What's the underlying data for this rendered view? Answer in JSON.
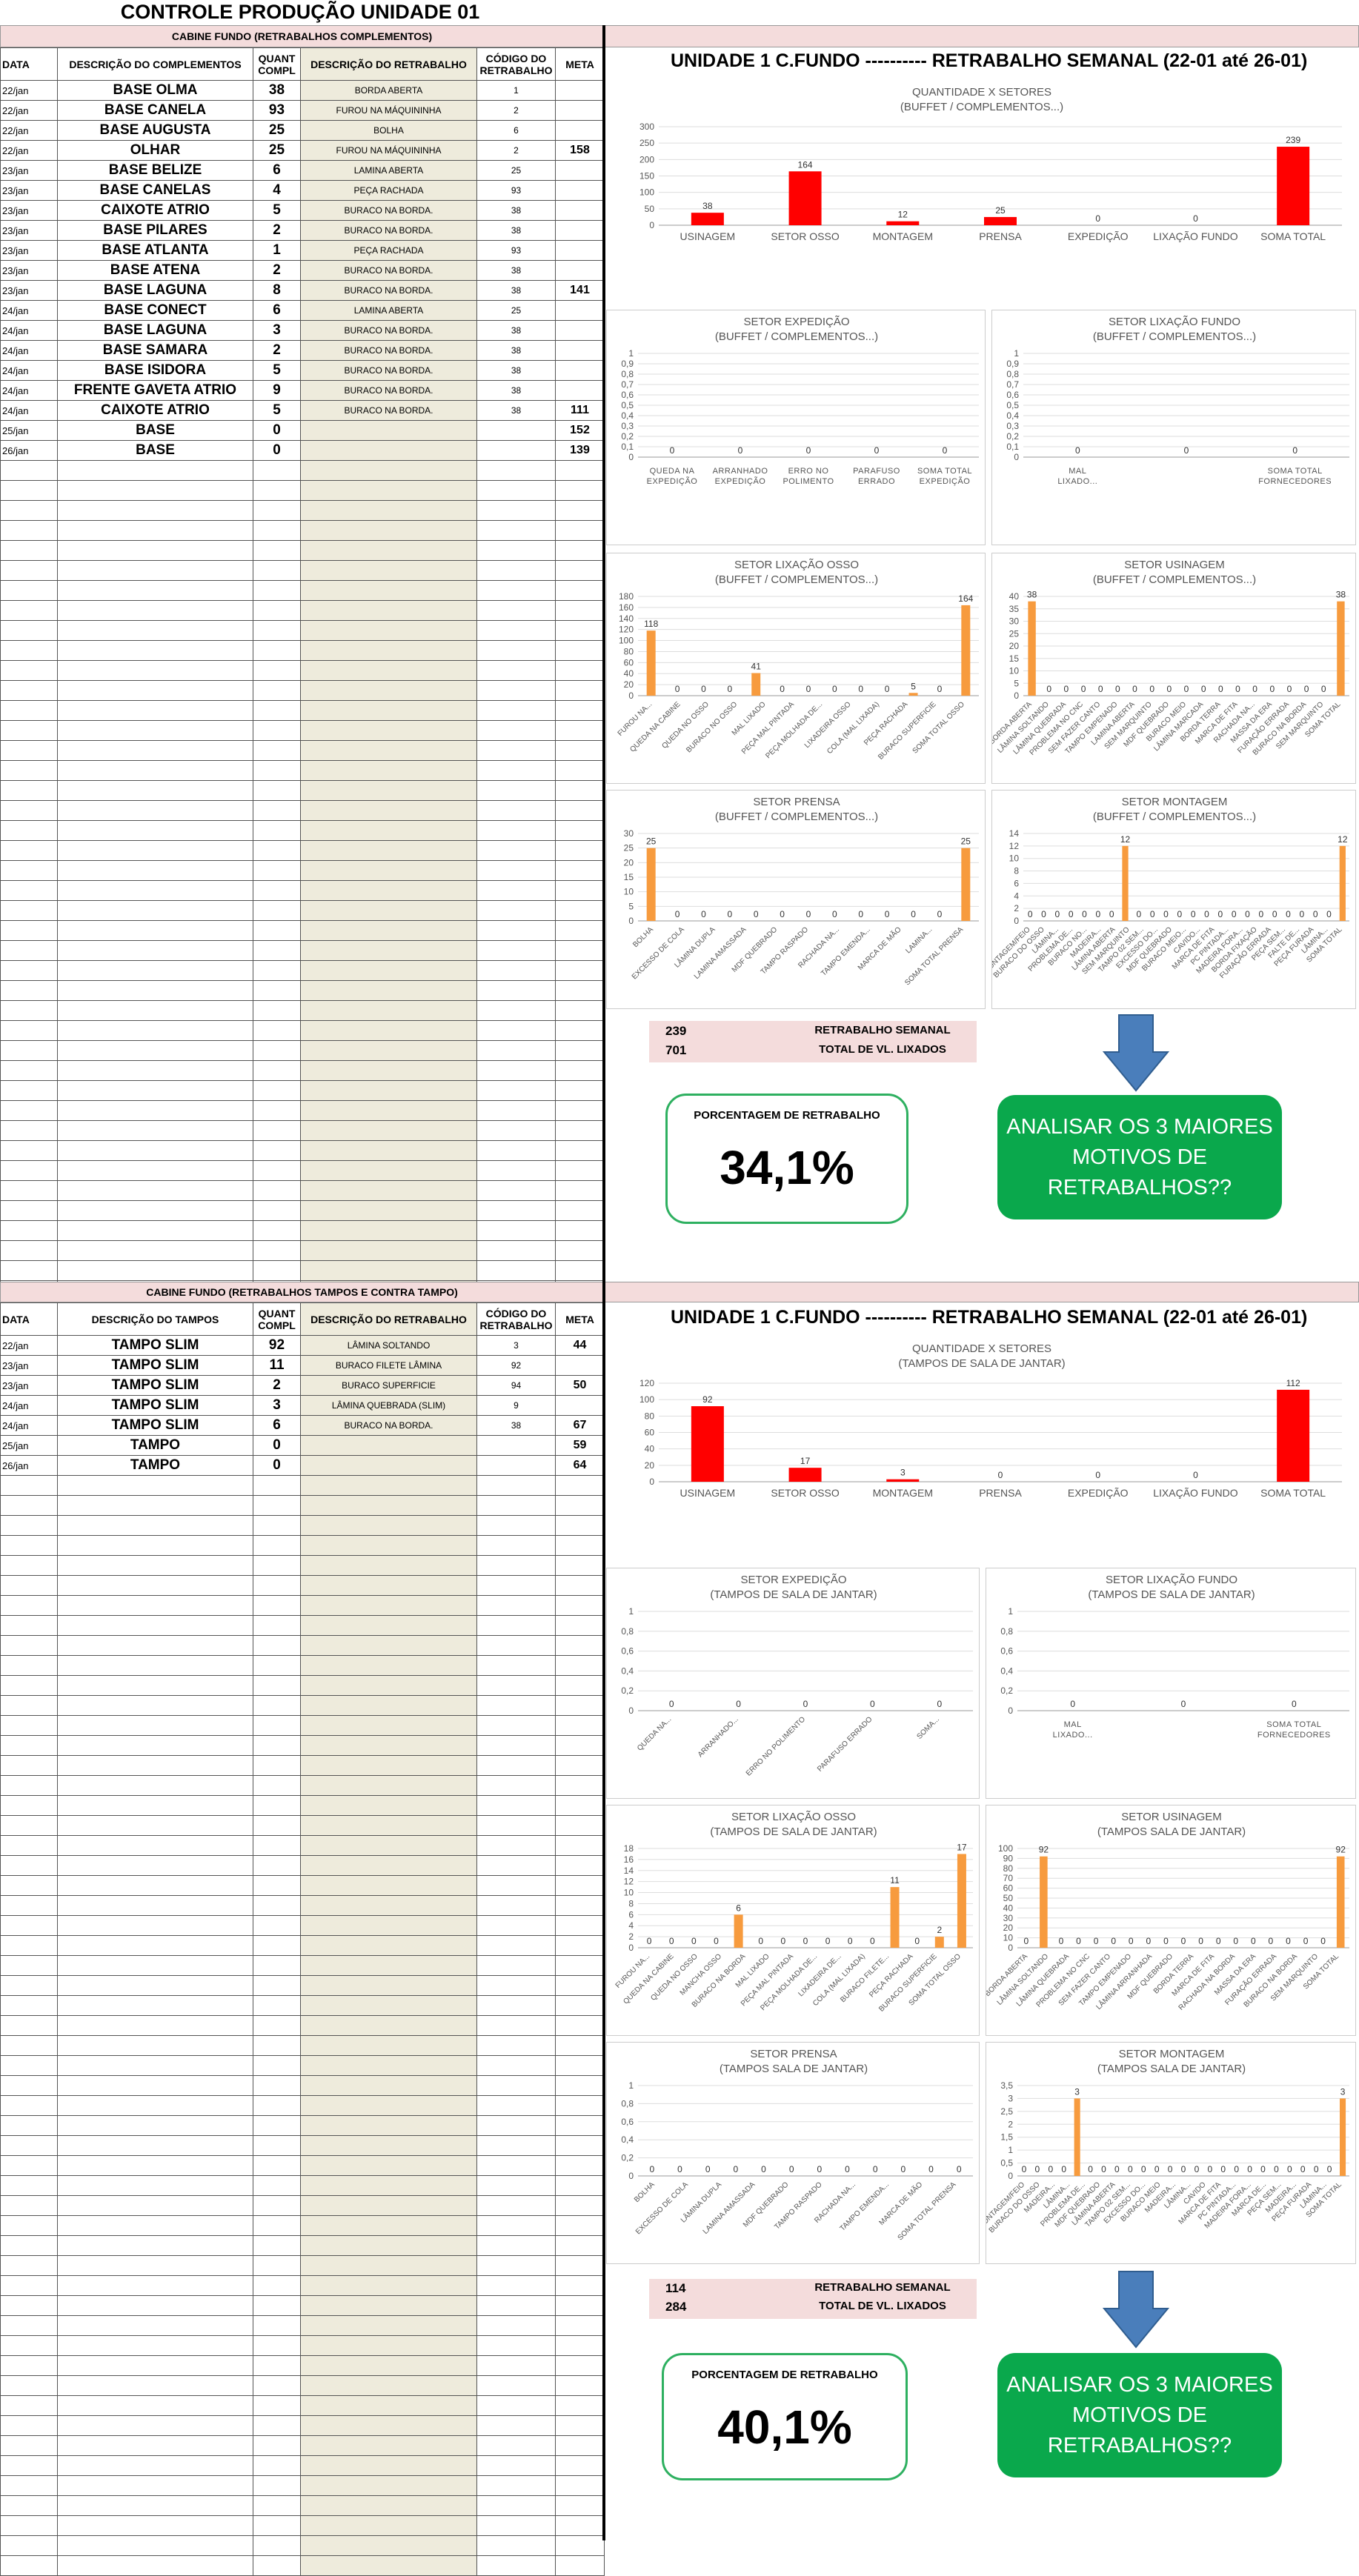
{
  "page_title": "CONTROLE PRODUÇÃO UNIDADE 01",
  "headers": {
    "data": "DATA",
    "descr_compl": "DESCRIÇÃO DO COMPLEMENTOS",
    "quant": "QUANT COMPL",
    "descr_retrab": "DESCRIÇÃO DO RETRABALHO",
    "codigo": "CÓDIGO DO RETRABALHO",
    "meta": "META",
    "descr_tampos": "DESCRIÇÃO DO TAMPOS"
  },
  "section1": {
    "band": "CABINE FUNDO (RETRABALHOS COMPLEMENTOS)",
    "rows": [
      [
        "22/jan",
        "BASE OLMA",
        "38",
        "BORDA ABERTA",
        "1",
        ""
      ],
      [
        "22/jan",
        "BASE CANELA",
        "93",
        "FUROU NA MÁQUININHA",
        "2",
        ""
      ],
      [
        "22/jan",
        "BASE AUGUSTA",
        "25",
        "BOLHA",
        "6",
        ""
      ],
      [
        "22/jan",
        "OLHAR",
        "25",
        "FUROU NA MÁQUININHA",
        "2",
        "158"
      ],
      [
        "23/jan",
        "BASE BELIZE",
        "6",
        "LAMINA ABERTA",
        "25",
        ""
      ],
      [
        "23/jan",
        "BASE CANELAS",
        "4",
        "PEÇA RACHADA",
        "93",
        ""
      ],
      [
        "23/jan",
        "CAIXOTE ATRIO",
        "5",
        "BURACO NA BORDA.",
        "38",
        ""
      ],
      [
        "23/jan",
        "BASE PILARES",
        "2",
        "BURACO NA BORDA.",
        "38",
        ""
      ],
      [
        "23/jan",
        "BASE ATLANTA",
        "1",
        "PEÇA RACHADA",
        "93",
        ""
      ],
      [
        "23/jan",
        "BASE ATENA",
        "2",
        "BURACO NA BORDA.",
        "38",
        ""
      ],
      [
        "23/jan",
        "BASE LAGUNA",
        "8",
        "BURACO NA BORDA.",
        "38",
        "141"
      ],
      [
        "24/jan",
        "BASE CONECT",
        "6",
        "LAMINA ABERTA",
        "25",
        ""
      ],
      [
        "24/jan",
        "BASE LAGUNA",
        "3",
        "BURACO NA BORDA.",
        "38",
        ""
      ],
      [
        "24/jan",
        "BASE SAMARA",
        "2",
        "BURACO NA BORDA.",
        "38",
        ""
      ],
      [
        "24/jan",
        "BASE ISIDORA",
        "5",
        "BURACO NA BORDA.",
        "38",
        ""
      ],
      [
        "24/jan",
        "FRENTE GAVETA ATRIO",
        "9",
        "BURACO NA BORDA.",
        "38",
        ""
      ],
      [
        "24/jan",
        "CAIXOTE ATRIO",
        "5",
        "BURACO NA BORDA.",
        "38",
        "111"
      ],
      [
        "25/jan",
        "BASE",
        "0",
        "",
        "",
        "152"
      ],
      [
        "26/jan",
        "BASE",
        "0",
        "",
        "",
        "139"
      ]
    ],
    "main_title": "UNIDADE 1 C.FUNDO ----------   RETRABALHO SEMANAL (22-01 até 26-01)",
    "summary": {
      "val1": "239",
      "lbl1": "RETRABALHO SEMANAL",
      "val2": "701",
      "lbl2": "TOTAL DE VL. LIXADOS"
    },
    "pct_label": "PORCENTAGEM DE RETRABALHO",
    "pct_value": "34,1%",
    "action_text": "ANALISAR OS 3 MAIORES MOTIVOS DE RETRABALHOS??"
  },
  "section2": {
    "band": "CABINE FUNDO (RETRABALHOS TAMPOS E CONTRA TAMPO)",
    "rows": [
      [
        "22/jan",
        "TAMPO SLIM",
        "92",
        "LÂMINA SOLTANDO",
        "3",
        "44"
      ],
      [
        "23/jan",
        "TAMPO SLIM",
        "11",
        "BURACO FILETE LÂMINA",
        "92",
        ""
      ],
      [
        "23/jan",
        "TAMPO SLIM",
        "2",
        "BURACO SUPERFICIE",
        "94",
        "50"
      ],
      [
        "24/jan",
        "TAMPO SLIM",
        "3",
        "LÂMINA QUEBRADA (SLIM)",
        "9",
        ""
      ],
      [
        "24/jan",
        "TAMPO SLIM",
        "6",
        "BURACO NA BORDA.",
        "38",
        "67"
      ],
      [
        "25/jan",
        "TAMPO",
        "0",
        "",
        "",
        "59"
      ],
      [
        "26/jan",
        "TAMPO",
        "0",
        "",
        "",
        "64"
      ]
    ],
    "main_title": "UNIDADE 1 C.FUNDO ----------   RETRABALHO SEMANAL (22-01 até 26-01)",
    "summary": {
      "val1": "114",
      "lbl1": "RETRABALHO SEMANAL",
      "val2": "284",
      "lbl2": "TOTAL DE VL. LIXADOS"
    },
    "pct_label": "PORCENTAGEM DE RETRABALHO",
    "pct_value": "40,1%",
    "action_text": "ANALISAR OS 3 MAIORES MOTIVOS DE RETRABALHOS??"
  },
  "colors": {
    "red": "#ff0000",
    "orange": "#f79b3e",
    "green": "#0aa84c",
    "arrow": "#4a7ebb",
    "pink": "#f4dcdc"
  },
  "chart_data": [
    {
      "id": "c1",
      "type": "bar",
      "title": "QUANTIDADE X SETORES",
      "subtitle": "(BUFFET / COMPLEMENTOS...)",
      "color": "red",
      "categories": [
        "USINAGEM",
        "SETOR OSSO",
        "MONTAGEM",
        "PRENSA",
        "EXPEDIÇÃO",
        "LIXAÇÃO FUNDO",
        "SOMA TOTAL"
      ],
      "values": [
        38,
        164,
        12,
        25,
        0,
        0,
        239
      ],
      "ylim": [
        0,
        300
      ],
      "yticks": [
        0,
        50,
        100,
        150,
        200,
        250,
        300
      ]
    },
    {
      "id": "c2",
      "type": "bar",
      "title": "SETOR EXPEDIÇÃO",
      "subtitle": "(BUFFET / COMPLEMENTOS...)",
      "color": "orange",
      "categories": [
        "QUEDA NA EXPEDIÇÃO",
        "ARRANHADO EXPEDIÇÃO",
        "ERRO NO POLIMENTO",
        "PARAFUSO ERRADO",
        "SOMA TOTAL EXPEDIÇÃO"
      ],
      "values": [
        0,
        0,
        0,
        0,
        0
      ],
      "ylim": [
        0,
        1
      ],
      "yticks": [
        0,
        0.1,
        0.2,
        0.3,
        0.4,
        0.5,
        0.6,
        0.7,
        0.8,
        0.9,
        1
      ]
    },
    {
      "id": "c3",
      "type": "bar",
      "title": "SETOR LIXAÇÃO FUNDO",
      "subtitle": "(BUFFET / COMPLEMENTOS...)",
      "color": "orange",
      "categories": [
        "MAL LIXADO...",
        "",
        "SOMA TOTAL FORNECEDORES"
      ],
      "values": [
        0,
        0,
        0
      ],
      "ylim": [
        0,
        1
      ],
      "yticks": [
        0,
        0.1,
        0.2,
        0.3,
        0.4,
        0.5,
        0.6,
        0.7,
        0.8,
        0.9,
        1
      ]
    },
    {
      "id": "c4",
      "type": "bar",
      "title": "SETOR  LIXAÇÃO OSSO",
      "subtitle": "(BUFFET / COMPLEMENTOS...)",
      "color": "orange",
      "categories": [
        "FUROU NA...",
        "QUEDA NA CABINE",
        "QUEDA NO OSSO",
        "BURACO NO OSSO",
        "MAL LIXADO",
        "PEÇA MAL PINTADA",
        "PEÇA MOLHADA DE...",
        "LIXADEIRA OSSO",
        "COLA (MAL LIXADA)",
        "PEÇA RACHADA",
        "BURACO SUPERFICIE",
        "SOMA TOTAL OSSO"
      ],
      "values": [
        118,
        0,
        0,
        0,
        41,
        0,
        0,
        0,
        0,
        0,
        5,
        0,
        164
      ],
      "ylim": [
        0,
        180
      ],
      "yticks": [
        0,
        20,
        40,
        60,
        80,
        100,
        120,
        140,
        160,
        180
      ]
    },
    {
      "id": "c5",
      "type": "bar",
      "title": "SETOR USINAGEM",
      "subtitle": "(BUFFET / COMPLEMENTOS...)",
      "color": "orange",
      "categories": [
        "BORDA ABERTA",
        "LÂMINA SOLTANDO",
        "LÂMINA QUEBRADA",
        "PROBLEMA NO CNC",
        "SEM FAZER CANTO",
        "TAMPO EMPENADO",
        "LAMINA ABERTA",
        "SEM MARQUINTO",
        "MDF QUEBRADO",
        "BURACO MEIO",
        "LÂMINA MARCADA",
        "BORDA TERRA",
        "MARCA DE FITA",
        "RACHADA NA...",
        "MASSA DA ERA",
        "FURAÇÃO ERRADA",
        "BURACO NA BORDA",
        "SEM MARQUINTO",
        "SOMA TOTAL"
      ],
      "values": [
        38,
        0,
        0,
        0,
        0,
        0,
        0,
        0,
        0,
        0,
        0,
        0,
        0,
        0,
        0,
        0,
        0,
        0,
        38
      ],
      "ylim": [
        0,
        40
      ],
      "yticks": [
        0,
        5,
        10,
        15,
        20,
        25,
        30,
        35,
        40
      ]
    },
    {
      "id": "c6",
      "type": "bar",
      "title": "SETOR PRENSA",
      "subtitle": "(BUFFET / COMPLEMENTOS...)",
      "color": "orange",
      "categories": [
        "BOLHA",
        "EXCESSO DE COLA",
        "LÂMINA DUPLA",
        "LAMINA AMASSADA",
        "MDF QUEBRADO",
        "TAMPO RASPADO",
        "RACHADA NA...",
        "TAMPO EMENDA...",
        "MARCA DE MÃO",
        "LAMINA...",
        "SOMA TOTAL PRENSA"
      ],
      "values": [
        25,
        0,
        0,
        0,
        0,
        0,
        0,
        0,
        0,
        0,
        0,
        0,
        25
      ],
      "ylim": [
        0,
        30
      ],
      "yticks": [
        0,
        5,
        10,
        15,
        20,
        25,
        30
      ]
    },
    {
      "id": "c7",
      "type": "bar",
      "title": "SETOR MONTAGEM",
      "subtitle": "(BUFFET / COMPLEMENTOS...)",
      "color": "orange",
      "categories": [
        "MONTAGEM/FEIO",
        "BURACO DO OSSO",
        "LÂMINA...",
        "PROBLEMA DE...",
        "BURACO NO...",
        "MADEIRA...",
        "LÂMINA ABERTA",
        "SEM MARQUINTO",
        "TAMPO 02 SEM...",
        "EXCESSO DO...",
        "MDF QUEBRADO",
        "BURACO MEIO...",
        "CAVIDO...",
        "MARCA DE FITA",
        "PC PINTADA...",
        "MADEIRA FORA...",
        "BORDA FIXAÇÃO",
        "FURAÇÃO ERRADA",
        "PEÇA SEM...",
        "FALTE DE...",
        "PEÇA FURADA",
        "LÂMINA...",
        "SOMA TOTAL"
      ],
      "values": [
        0,
        0,
        0,
        0,
        0,
        0,
        0,
        12,
        0,
        0,
        0,
        0,
        0,
        0,
        0,
        0,
        0,
        0,
        0,
        0,
        0,
        0,
        0,
        12
      ],
      "ylim": [
        0,
        14
      ],
      "yticks": [
        0,
        2,
        4,
        6,
        8,
        10,
        12,
        14
      ]
    },
    {
      "id": "t1",
      "type": "bar",
      "title": "QUANTIDADE X SETORES",
      "subtitle": "(TAMPOS DE SALA DE JANTAR)",
      "color": "red",
      "categories": [
        "USINAGEM",
        "SETOR  OSSO",
        "MONTAGEM",
        "PRENSA",
        "EXPEDIÇÃO",
        "LIXAÇÃO FUNDO",
        "SOMA TOTAL"
      ],
      "values": [
        92,
        17,
        3,
        0,
        0,
        0,
        112
      ],
      "ylim": [
        0,
        120
      ],
      "yticks": [
        0,
        20,
        40,
        60,
        80,
        100,
        120
      ]
    },
    {
      "id": "t2",
      "type": "bar",
      "title": "SETOR  EXPEDIÇÃO",
      "subtitle": "(TAMPOS DE SALA DE JANTAR)",
      "color": "orange",
      "categories": [
        "QUEDA NA...",
        "ARRANHADO...",
        "ERRO NO POLIMENTO",
        "PARAFUSO ERRADO",
        "SOMA..."
      ],
      "values": [
        0,
        0,
        0,
        0,
        0
      ],
      "ylim": [
        0,
        1
      ],
      "yticks": [
        0,
        0.2,
        0.4,
        0.6,
        0.8,
        1
      ]
    },
    {
      "id": "t3",
      "type": "bar",
      "title": "SETOR  LIXAÇÃO FUNDO",
      "subtitle": "(TAMPOS DE SALA DE JANTAR)",
      "color": "orange",
      "categories": [
        "MAL LIXADO...",
        "",
        "SOMA TOTAL FORNECEDORES"
      ],
      "values": [
        0,
        0,
        0
      ],
      "ylim": [
        0,
        1
      ],
      "yticks": [
        0,
        0.2,
        0.4,
        0.6,
        0.8,
        1
      ]
    },
    {
      "id": "t4",
      "type": "bar",
      "title": "SETOR  LIXAÇÃO OSSO",
      "subtitle": "(TAMPOS DE SALA DE JANTAR)",
      "color": "orange",
      "categories": [
        "FUROU NA...",
        "QUEDA NA CABINE",
        "QUEDA NO OSSO",
        "MANCHA OSSO",
        "BURACO NA BORDA",
        "MAL LIXADO",
        "PEÇA MAL PINTADA",
        "PEÇA MOLHADA DE...",
        "LIXADEIRA DE...",
        "COLA (MAL LIXADA)",
        "BURACO FILETE...",
        "PEÇA RACHADA",
        "BURACO SUPERFICIE",
        "SOMA TOTAL OSSO"
      ],
      "values": [
        0,
        0,
        0,
        0,
        6,
        0,
        0,
        0,
        0,
        0,
        0,
        11,
        0,
        2,
        17
      ],
      "ylim": [
        0,
        18
      ],
      "yticks": [
        0,
        2,
        4,
        6,
        8,
        10,
        12,
        14,
        16,
        18
      ]
    },
    {
      "id": "t5",
      "type": "bar",
      "title": "SETOR USINAGEM",
      "subtitle": "(TAMPOS SALA DE JANTAR)",
      "color": "orange",
      "categories": [
        "BORDA ABERTA",
        "LÂMINA SOLTANDO",
        "LÂMINA QUEBRADA",
        "PROBLEMA NO CNC",
        "SEM FAZER CANTO",
        "TAMPO EMPENADO",
        "LÂMINA ARRANHADA",
        "MDF QUEBRADO",
        "BORDA TERRA",
        "MARCA DE FITA",
        "RACHADA NA BORDA",
        "MASSA DA ERA",
        "FURAÇÃO ERRADA",
        "BURACO NA BORDA",
        "SEM MARQUINTO",
        "SOMA TOTAL"
      ],
      "values": [
        0,
        92,
        0,
        0,
        0,
        0,
        0,
        0,
        0,
        0,
        0,
        0,
        0,
        0,
        0,
        0,
        0,
        0,
        92
      ],
      "ylim": [
        0,
        100
      ],
      "yticks": [
        0,
        10,
        20,
        30,
        40,
        50,
        60,
        70,
        80,
        90,
        100
      ]
    },
    {
      "id": "t6",
      "type": "bar",
      "title": "SETOR PRENSA",
      "subtitle": "(TAMPOS SALA DE JANTAR)",
      "color": "orange",
      "categories": [
        "BOLHA",
        "EXCESSO DE COLA",
        "LÂMINA DUPLA",
        "LAMINA AMASSADA",
        "MDF QUEBRADO",
        "TAMPO RASPADO",
        "RACHADA NA...",
        "TAMPO EMENDA...",
        "MARCA DE MÃO",
        "SOMA TOTAL PRENSA"
      ],
      "values": [
        0,
        0,
        0,
        0,
        0,
        0,
        0,
        0,
        0,
        0,
        0,
        0
      ],
      "ylim": [
        0,
        1
      ],
      "yticks": [
        0,
        0.2,
        0.4,
        0.6,
        0.8,
        1
      ]
    },
    {
      "id": "t7",
      "type": "bar",
      "title": "SETOR MONTAGEM",
      "subtitle": "(TAMPOS SALA DE JANTAR)",
      "color": "orange",
      "categories": [
        "MONTAGEM/FEIO",
        "BURACO DO OSSO",
        "MADEIRA...",
        "LÂMINA...",
        "PROBLEMA DE...",
        "MDF QUEBRADO",
        "LÂMINA ABERTA",
        "TAMPO 02 SEM...",
        "EXCESSO DO...",
        "BURACO MEIO",
        "MADEIRA...",
        "LÂMINA...",
        "CAVIDO",
        "MARCA DE FITA",
        "PC PINTADA...",
        "MADEIRA FORA...",
        "MARCA DE...",
        "PEÇA SEM...",
        "MADEIRA...",
        "PEÇA FURADA",
        "LÂMINA...",
        "SOMA TOTAL"
      ],
      "values": [
        0,
        0,
        0,
        0,
        3,
        0,
        0,
        0,
        0,
        0,
        0,
        0,
        0,
        0,
        0,
        0,
        0,
        0,
        0,
        0,
        0,
        0,
        0,
        0,
        3
      ],
      "ylim": [
        0,
        3.5
      ],
      "yticks": [
        0,
        0.5,
        1,
        1.5,
        2,
        2.5,
        3,
        3.5
      ]
    }
  ]
}
